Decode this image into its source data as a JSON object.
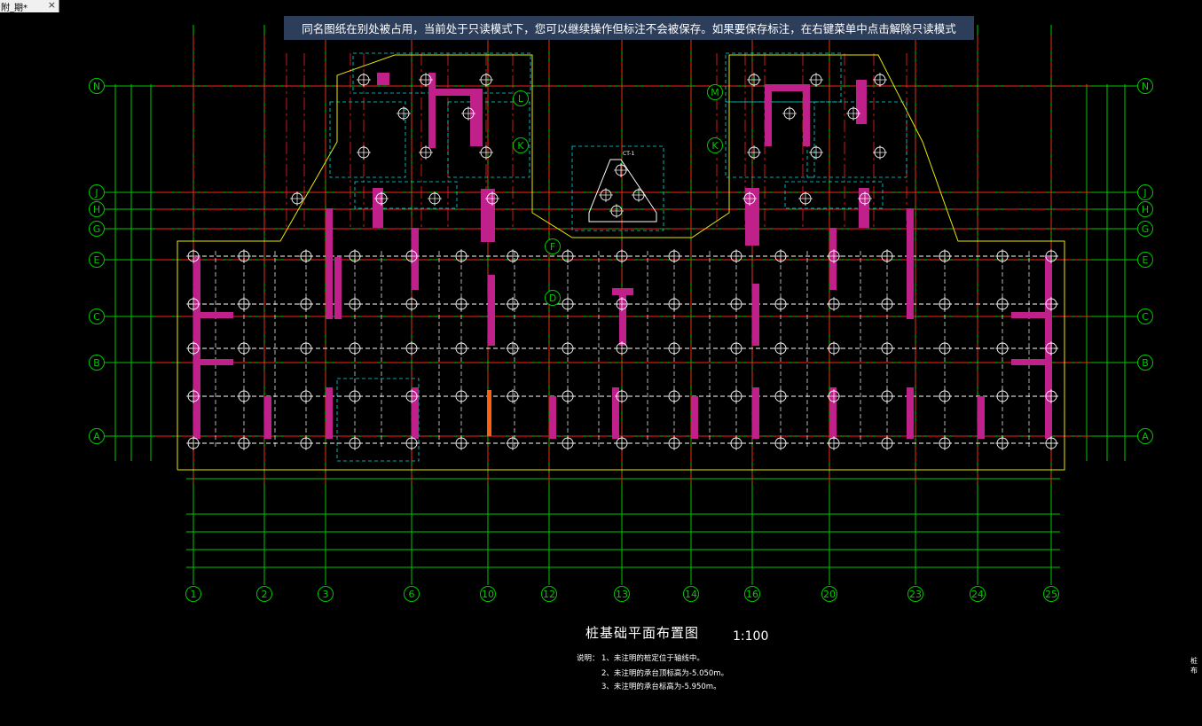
{
  "tab": {
    "title": "附_期*",
    "close": "×"
  },
  "notice": "同名图纸在别处被占用，当前处于只读模式下，您可以继续操作但标注不会被保存。如果要保存标注，在右键菜单中点击解除只读模式",
  "drawing": {
    "title": "桩基础平面布置图",
    "scale": "1:100",
    "notes_label": "说明：",
    "notes": [
      "1、未注明的桩定位于轴线中。",
      "2、未注明的承台顶标高为-5.050m。",
      "3、未注明的承台标高为-5.950m。"
    ],
    "row_axes": [
      "N",
      "J",
      "H",
      "G",
      "E",
      "C",
      "B",
      "A"
    ],
    "upper_axes_left": [
      "L",
      "K"
    ],
    "upper_axes_right": [
      "M",
      "K"
    ],
    "mid_axes": [
      "F",
      "D"
    ],
    "col_axes": [
      "1",
      "2",
      "3",
      "6",
      "10",
      "12",
      "13",
      "14",
      "16",
      "20",
      "23",
      "24",
      "25"
    ],
    "detail_label": "CT-1",
    "edge_text": "桩布"
  },
  "colors": {
    "grid": "#00c800",
    "axis_red": "#ff2020",
    "wall": "#c0208a",
    "outline": "#e8e800",
    "pile": "#ffffff",
    "cyan": "#00e0e0",
    "notice_bg": "#2d3e5a"
  }
}
